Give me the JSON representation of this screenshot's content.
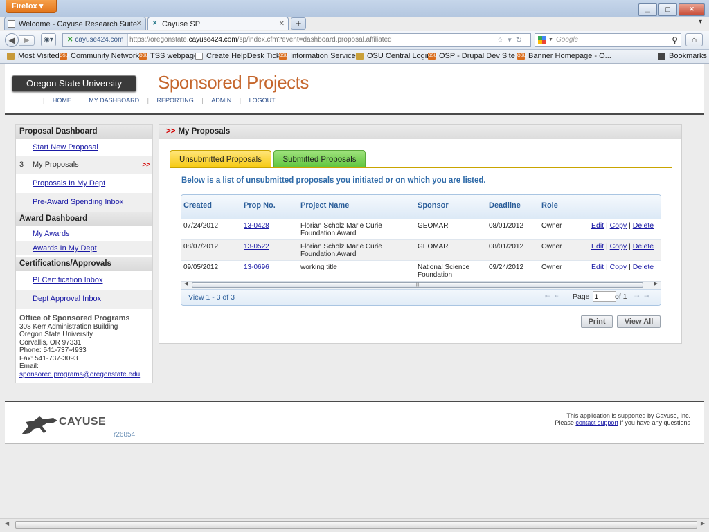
{
  "browser": {
    "menu_button": "Firefox",
    "tabs": [
      {
        "title": "Welcome - Cayuse Research Suite",
        "active": false
      },
      {
        "title": "Cayuse SP",
        "active": true
      }
    ],
    "identity": "cayuse424.com",
    "url_prefix": "https://oregonstate.",
    "url_domain": "cayuse424.com",
    "url_path": "/sp/index.cfm?event=dashboard.proposal.affiliated",
    "search_placeholder": "Google",
    "bookmarks": [
      "Most Visited",
      "Community Network",
      "TSS webpage",
      "Create HelpDesk Ticket",
      "Information Services",
      "OSU Central Login",
      "OSP - Drupal Dev Site |...",
      "Banner Homepage - O..."
    ],
    "bookmarks_menu": "Bookmarks"
  },
  "header": {
    "logo_text": "Oregon State University",
    "app_title": "Sponsored Projects",
    "nav": [
      "HOME",
      "MY DASHBOARD",
      "REPORTING",
      "ADMIN",
      "LOGOUT"
    ]
  },
  "sidebar": {
    "proposal_heading": "Proposal Dashboard",
    "start_new": "Start New Proposal",
    "my_proposals_count": "3",
    "my_proposals": "My Proposals",
    "active_marker": ">>",
    "proposals_dept": "Proposals In My Dept",
    "preaward": "Pre-Award Spending Inbox",
    "award_heading": "Award Dashboard",
    "my_awards": "My Awards",
    "awards_dept": "Awards In My Dept",
    "cert_heading": "Certifications/Approvals",
    "pi_cert": "PI Certification Inbox",
    "dept_approval": "Dept Approval Inbox",
    "office": {
      "name": "Office of Sponsored Programs",
      "address1": "308 Kerr Administration Building",
      "address2": "Oregon State University",
      "address3": "Corvallis, OR 97331",
      "phone": "Phone: 541-737-4933",
      "fax": "Fax: 541-737-3093",
      "email_label": "Email:",
      "email": "sponsored.programs@oregonstate.edu"
    }
  },
  "main": {
    "marker": ">>",
    "heading": "My Proposals",
    "tab_unsubmitted": "Unsubmitted Proposals",
    "tab_submitted": "Submitted Proposals",
    "intro": "Below is a list of unsubmitted proposals you initiated or on which you are listed.",
    "columns": {
      "created": "Created",
      "prop_no": "Prop No.",
      "project": "Project Name",
      "sponsor": "Sponsor",
      "deadline": "Deadline",
      "role": "Role"
    },
    "rows": [
      {
        "created": "07/24/2012",
        "prop_no": "13-0428",
        "project_1": "Florian Scholz Marie Curie",
        "project_2": "Foundation Award",
        "sponsor_1": "GEOMAR",
        "sponsor_2": "",
        "deadline": "08/01/2012",
        "role": "Owner"
      },
      {
        "created": "08/07/2012",
        "prop_no": "13-0522",
        "project_1": "Florian Scholz Marie Curie",
        "project_2": "Foundation Award",
        "sponsor_1": "GEOMAR",
        "sponsor_2": "",
        "deadline": "08/01/2012",
        "role": "Owner"
      },
      {
        "created": "09/05/2012",
        "prop_no": "13-0696",
        "project_1": "working title",
        "project_2": "",
        "sponsor_1": "National Science",
        "sponsor_2": "Foundation",
        "deadline": "09/24/2012",
        "role": "Owner"
      }
    ],
    "actions": {
      "edit": "Edit",
      "copy": "Copy",
      "delete": "Delete",
      "sep": "|"
    },
    "pager": {
      "view": "View 1 - 3 of 3",
      "page_label": "Page",
      "page_value": "1",
      "of": "of 1"
    },
    "print": "Print",
    "view_all": "View All"
  },
  "footer": {
    "brand": "CAYUSE",
    "revision": "r26854",
    "support_line1": "This application is supported by Cayuse, Inc.",
    "support_pre": "Please ",
    "support_link": "contact support",
    "support_post": " if you have any questions"
  }
}
